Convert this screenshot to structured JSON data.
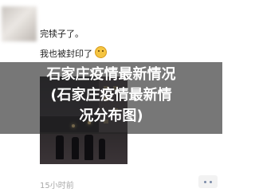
{
  "post": {
    "line1": "完犊子了。",
    "line2": "我也被封印了",
    "emoji_icon": "worried-face-icon",
    "time": "15小时前"
  },
  "overlay": {
    "title_line1": "石家庄疫情最新情况",
    "title_line2": "(石家庄疫情最新情",
    "title_line3": "况分布图)"
  },
  "colors": {
    "overlay": "#232323",
    "timestamp": "#a8a8a8",
    "action_dots": "#7a8aa8"
  }
}
